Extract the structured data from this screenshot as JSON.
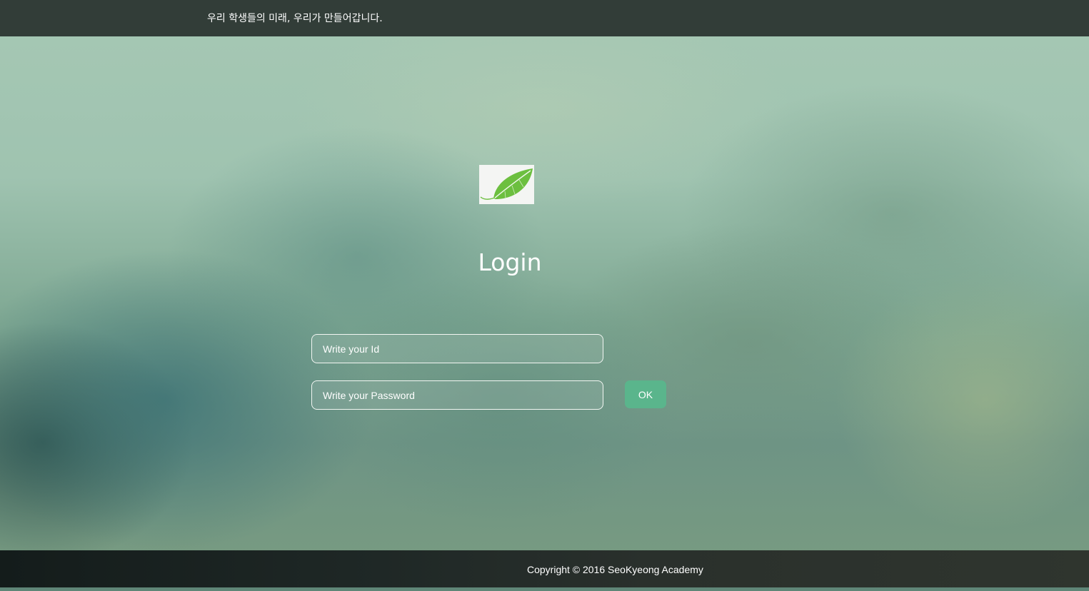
{
  "header": {
    "slogan": "우리 학생들의 미래, 우리가 만들어갑니다."
  },
  "logo": {
    "icon": "leaf-icon",
    "leaf_color": "#6cbf3f"
  },
  "login": {
    "title": "Login",
    "id_placeholder": "Write your Id",
    "password_placeholder": "Write your Password",
    "ok_label": "OK"
  },
  "footer": {
    "copyright": "Copyright © 2016 SeoKyeong Academy"
  },
  "colors": {
    "topbar": "#323d38",
    "button": "#5ab58c",
    "footer": "#1f2826"
  }
}
